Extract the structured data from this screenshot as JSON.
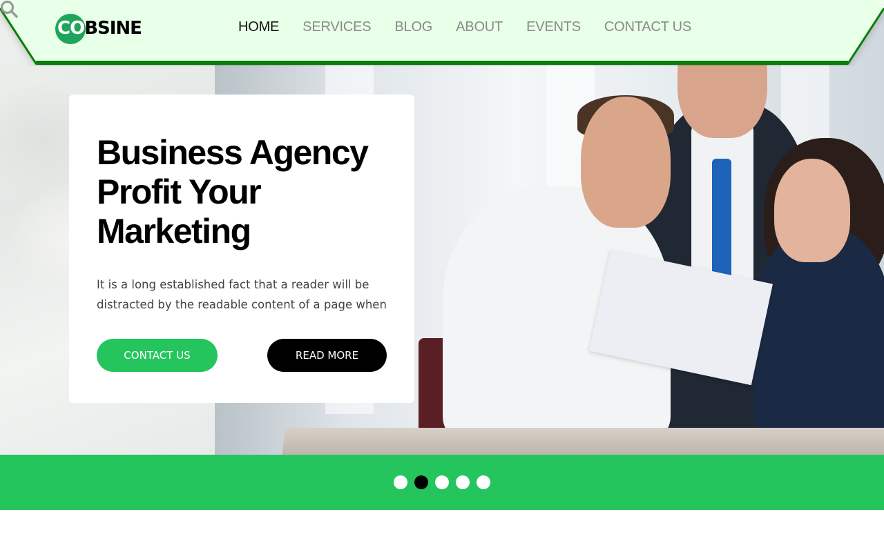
{
  "brand": {
    "logo_prefix": "CO",
    "logo_suffix": "BSINE"
  },
  "nav": {
    "items": [
      {
        "label": "HOME",
        "active": true
      },
      {
        "label": "SERVICES",
        "active": false
      },
      {
        "label": "BLOG",
        "active": false
      },
      {
        "label": "ABOUT",
        "active": false
      },
      {
        "label": "EVENTS",
        "active": false
      },
      {
        "label": "CONTACT US",
        "active": false
      }
    ],
    "search_icon": "search-icon"
  },
  "hero": {
    "title_line1": "Business Agency",
    "title_line2": "Profit Your",
    "title_line3": "Marketing",
    "description": "It is a long established fact that a reader will be distracted by the readable content of a page when",
    "contact_label": "CONTACT US",
    "read_more_label": "READ MORE"
  },
  "slider": {
    "count": 5,
    "active_index": 1
  },
  "colors": {
    "accent_green": "#25c55e",
    "header_bg": "#e8ffe8",
    "header_border": "#0a7f0a",
    "logo_circle": "#1fa55b"
  }
}
